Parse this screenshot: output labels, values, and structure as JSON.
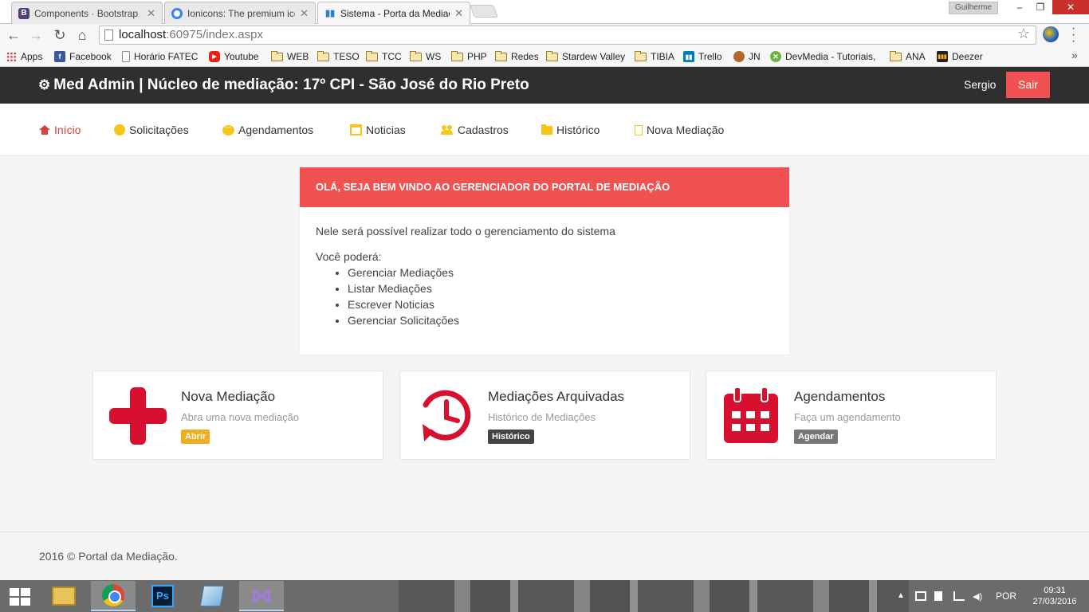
{
  "browser": {
    "tabs": [
      {
        "title": "Components · Bootstrap",
        "favicon": "bootstrap-icon",
        "active": false
      },
      {
        "title": "Ionicons: The premium icon",
        "favicon": "ionicons-icon",
        "active": false
      },
      {
        "title": "Sistema - Porta da Mediação",
        "favicon": "chart-icon",
        "active": true
      }
    ],
    "window_user": "Guilherme",
    "url_host": "localhost",
    "url_rest": ":60975/index.aspx",
    "bookmarks": [
      {
        "label": "Apps",
        "icon": "apps-grid-icon"
      },
      {
        "label": "Facebook",
        "icon": "facebook-icon"
      },
      {
        "label": "Horário FATEC",
        "icon": "page-icon"
      },
      {
        "label": "Youtube",
        "icon": "youtube-icon"
      },
      {
        "label": "WEB",
        "icon": "folder-icon"
      },
      {
        "label": "TESO",
        "icon": "folder-icon"
      },
      {
        "label": "TCC",
        "icon": "folder-icon"
      },
      {
        "label": "WS",
        "icon": "folder-icon"
      },
      {
        "label": "PHP",
        "icon": "folder-icon"
      },
      {
        "label": "Redes",
        "icon": "folder-icon"
      },
      {
        "label": "Stardew Valley",
        "icon": "folder-icon"
      },
      {
        "label": "TIBIA",
        "icon": "folder-icon"
      },
      {
        "label": "Trello",
        "icon": "trello-icon"
      },
      {
        "label": "JN",
        "icon": "jn-icon"
      },
      {
        "label": "DevMedia - Tutoriais,",
        "icon": "devmedia-icon"
      },
      {
        "label": "ANA",
        "icon": "folder-icon"
      },
      {
        "label": "Deezer",
        "icon": "deezer-icon"
      }
    ]
  },
  "header": {
    "brand": "Med Admin | Núcleo de mediação: 17º CPI - São José do Rio Preto",
    "user": "Sergio",
    "logout": "Sair"
  },
  "nav": [
    {
      "label": "Início",
      "icon": "home-icon",
      "active": true
    },
    {
      "label": "Solicitações",
      "icon": "circle-icon",
      "active": false
    },
    {
      "label": "Agendamentos",
      "icon": "chat-icon",
      "active": false
    },
    {
      "label": "Noticias",
      "icon": "calendar-icon",
      "active": false
    },
    {
      "label": "Cadastros",
      "icon": "users-icon",
      "active": false
    },
    {
      "label": "Histórico",
      "icon": "folder-icon",
      "active": false
    },
    {
      "label": "Nova Mediação",
      "icon": "file-icon",
      "active": false
    }
  ],
  "welcome": {
    "heading": "OLÁ, SEJA BEM VINDO AO GERENCIADOR DO PORTAL DE MEDIAÇÃO",
    "intro": "Nele será possível realizar todo o gerenciamento do sistema",
    "lead": "Você poderá:",
    "items": [
      "Gerenciar Mediações",
      "Listar Mediações",
      "Escrever Noticias",
      "Gerenciar Solicitações"
    ]
  },
  "cards": [
    {
      "title": "Nova Mediação",
      "subtitle": "Abra uma nova mediação",
      "badge": "Abrir",
      "icon": "plus-icon"
    },
    {
      "title": "Mediações Arquivadas",
      "subtitle": "Histórico de Mediações",
      "badge": "Histórico",
      "icon": "history-icon"
    },
    {
      "title": "Agendamentos",
      "subtitle": "Faça um agendamento",
      "badge": "Agendar",
      "icon": "calendar-icon"
    }
  ],
  "footer": {
    "text": "2016 © Portal da Mediação."
  },
  "taskbar": {
    "language": "POR",
    "time": "09:31",
    "date": "27/03/2016"
  },
  "colors": {
    "accent": "#f05151",
    "header_bg": "#2f2f2f",
    "nav_icon": "#f5c518",
    "card_icon": "#d7102f"
  }
}
